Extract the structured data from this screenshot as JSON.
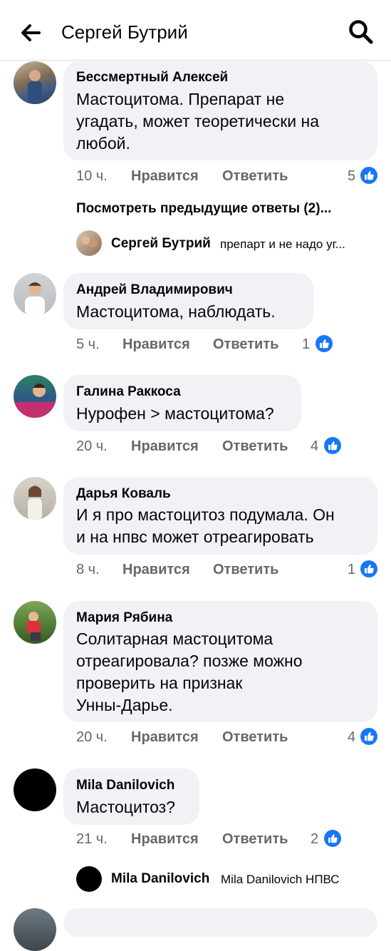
{
  "header": {
    "title": "Сергей Бутрий"
  },
  "comments": [
    {
      "name": "Бессмертный Алексей",
      "lines": [
        "Мастоцитома. Препарат не",
        "угадать, может теоретически на",
        "любой."
      ],
      "time": "10 ч.",
      "like": "Нравится",
      "reply": "Ответить",
      "reactions": "5"
    },
    {
      "name": "Андрей Владимирович",
      "lines": [
        "Мастоцитома, наблюдать."
      ],
      "time": "5 ч.",
      "like": "Нравится",
      "reply": "Ответить",
      "reactions": "1"
    },
    {
      "name": "Галина Раккоса",
      "lines": [
        "Нурофен > мастоцитома?"
      ],
      "time": "20 ч.",
      "like": "Нравится",
      "reply": "Ответить",
      "reactions": "4"
    },
    {
      "name": "Дарья Коваль",
      "lines": [
        "И я про мастоцитоз подумала. Он",
        "и на нпвс может отреагировать"
      ],
      "time": "8 ч.",
      "like": "Нравится",
      "reply": "Ответить",
      "reactions": "1"
    },
    {
      "name": "Мария Рябина",
      "lines": [
        "Солитарная мастоцитома",
        "отреагировала? позже можно",
        "проверить на признак",
        "Унны-Дарье."
      ],
      "time": "20 ч.",
      "like": "Нравится",
      "reply": "Ответить",
      "reactions": "4"
    },
    {
      "name": "Mila Danilovich",
      "lines": [
        "Мастоцитоз?"
      ],
      "time": "21 ч.",
      "like": "Нравится",
      "reply": "Ответить",
      "reactions": "2"
    }
  ],
  "previous_replies": "Посмотреть предыдущие ответы (2)...",
  "replies": [
    {
      "name": "Сергей Бутрий",
      "text": "препарт и не надо уг..."
    },
    {
      "name": "Mila Danilovich",
      "text": "Mila Danilovich НПВС"
    }
  ],
  "colors": {
    "like_blue": "#1877f2",
    "bubble": "#f0f2f5",
    "meta": "#65676b"
  }
}
